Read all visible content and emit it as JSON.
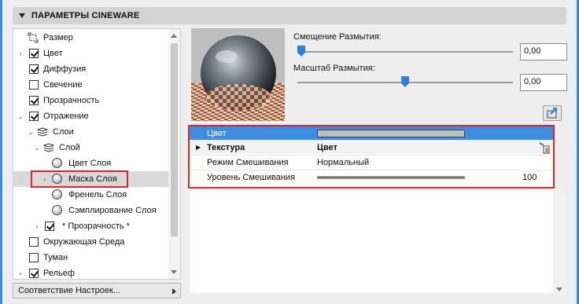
{
  "panel": {
    "title": "ПАРАМЕТРЫ CINEWARE"
  },
  "tree": {
    "items": [
      {
        "label": "Размер",
        "icon": "resize-icon"
      },
      {
        "label": "Цвет",
        "checked": true
      },
      {
        "label": "Диффузия",
        "checked": true
      },
      {
        "label": "Свечение",
        "checked": false
      },
      {
        "label": "Прозрачность",
        "checked": true
      },
      {
        "label": "Отражение",
        "checked": true
      },
      {
        "label": "Слои",
        "icon": "layers-icon"
      },
      {
        "label": "Слой",
        "icon": "layers-icon"
      },
      {
        "label": "Цвет Слоя",
        "icon": "sphere-icon"
      },
      {
        "label": "Маска Слоя",
        "icon": "sphere-icon",
        "selected": true
      },
      {
        "label": "Френель Слоя",
        "icon": "sphere-icon"
      },
      {
        "label": "Сэмплирование Слоя",
        "icon": "sphere-icon"
      },
      {
        "label": "* Прозрачность *",
        "checked": true
      },
      {
        "label": "Окружающая Среда",
        "checked": false
      },
      {
        "label": "Туман",
        "checked": false
      },
      {
        "label": "Рельеф",
        "checked": true
      }
    ],
    "dropdown_label": "Соответствие Настроек..."
  },
  "settings": {
    "blur_offset_label": "Смещение Размытия:",
    "blur_offset_value": "0,00",
    "blur_offset_level": 0.0,
    "blur_scale_label": "Масштаб Размытия:",
    "blur_scale_value": "0,00",
    "blur_scale_level": 0.5
  },
  "table": {
    "color_row": {
      "name": "Цвет",
      "swatch": "#bdbdbd"
    },
    "texture_row": {
      "name": "Текстура",
      "value": "Цвет"
    },
    "blend_mode_row": {
      "name": "Режим Смешивания",
      "value": "Нормальный"
    },
    "blend_level_row": {
      "name": "Уровень Смешивания",
      "value": "100",
      "level": 1.0
    }
  },
  "colors": {
    "highlight": "#3d8ee0",
    "annotation_red": "#e0262c"
  }
}
